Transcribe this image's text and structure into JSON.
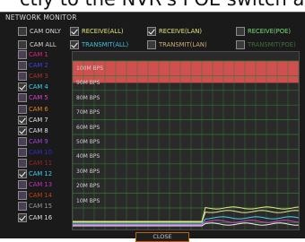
{
  "caption": "ctly to the NVR's POE switch and",
  "window_title": "NETWORK MONITOR",
  "filters_left": [
    {
      "label": "CAM ONLY",
      "checked": false,
      "color": "#d8d8d8"
    },
    {
      "label": "CAM ALL",
      "checked": false,
      "color": "#d8d8d8"
    }
  ],
  "filters": [
    {
      "label": "RECEIVE(ALL)",
      "checked": true,
      "color": "#e2e87a"
    },
    {
      "label": "RECEIVE(LAN)",
      "checked": true,
      "color": "#e2e87a"
    },
    {
      "label": "RECEIVE(POE)",
      "checked": false,
      "color": "#7be07b"
    },
    {
      "label": "TRANSMIT(ALL)",
      "checked": true,
      "color": "#3fc0e0"
    },
    {
      "label": "TRANSMIT(LAN)",
      "checked": false,
      "color": "#c8b070"
    },
    {
      "label": "TRANSMIT(POE)",
      "checked": false,
      "color": "#3f6f3f"
    }
  ],
  "cameras": [
    {
      "label": "CAM 1",
      "checked": false,
      "color": "#e0208a"
    },
    {
      "label": "CAM 2",
      "checked": false,
      "color": "#4a3ae8"
    },
    {
      "label": "CAM 3",
      "checked": false,
      "color": "#b03030"
    },
    {
      "label": "CAM 4",
      "checked": true,
      "color": "#40d0f0"
    },
    {
      "label": "CAM 5",
      "checked": false,
      "color": "#e040d0"
    },
    {
      "label": "CAM 6",
      "checked": false,
      "color": "#e08020"
    },
    {
      "label": "CAM 7",
      "checked": true,
      "color": "#e0e0e0"
    },
    {
      "label": "CAM 8",
      "checked": true,
      "color": "#e0e0e0"
    },
    {
      "label": "CAM 9",
      "checked": false,
      "color": "#a040e0"
    },
    {
      "label": "CAM 10",
      "checked": false,
      "color": "#3030c0"
    },
    {
      "label": "CAM 11",
      "checked": false,
      "color": "#a02020"
    },
    {
      "label": "CAM 12",
      "checked": true,
      "color": "#40d0f0"
    },
    {
      "label": "CAM 13",
      "checked": false,
      "color": "#c030c0"
    },
    {
      "label": "CAM 14",
      "checked": false,
      "color": "#c04010"
    },
    {
      "label": "CAM 15",
      "checked": false,
      "color": "#9a9a9a"
    },
    {
      "label": "CAM 16",
      "checked": true,
      "color": "#e0e0e0"
    }
  ],
  "graph": {
    "y_labels": [
      "100M BPS",
      "90M BPS",
      "80M BPS",
      "70M BPS",
      "60M BPS",
      "50M BPS",
      "40M BPS",
      "30M BPS",
      "20M BPS",
      "10M BPS"
    ],
    "highlight_color": "#d05050",
    "grid_color": "#2f7a2f"
  },
  "close_label": "CLOSE"
}
